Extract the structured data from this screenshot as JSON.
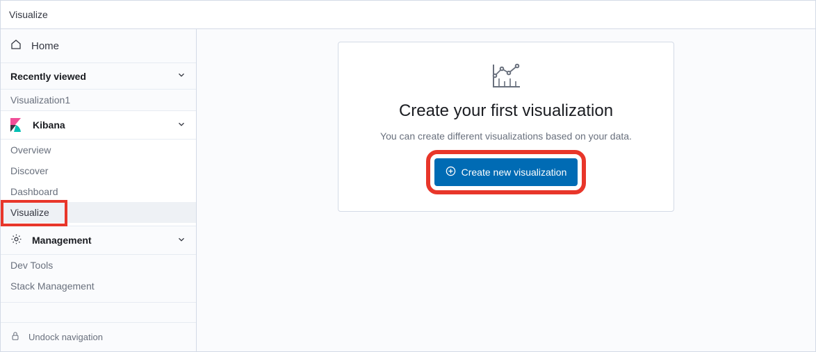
{
  "breadcrumb": "Visualize",
  "sidebar": {
    "home_label": "Home",
    "recently_viewed": {
      "title": "Recently viewed",
      "items": [
        "Visualization1"
      ]
    },
    "kibana": {
      "title": "Kibana",
      "items": [
        "Overview",
        "Discover",
        "Dashboard",
        "Visualize"
      ]
    },
    "management": {
      "title": "Management",
      "items": [
        "Dev Tools",
        "Stack Management"
      ]
    },
    "undock_label": "Undock navigation"
  },
  "main_card": {
    "title": "Create your first visualization",
    "description": "You can create different visualizations based on your data.",
    "button_label": "Create new visualization"
  }
}
